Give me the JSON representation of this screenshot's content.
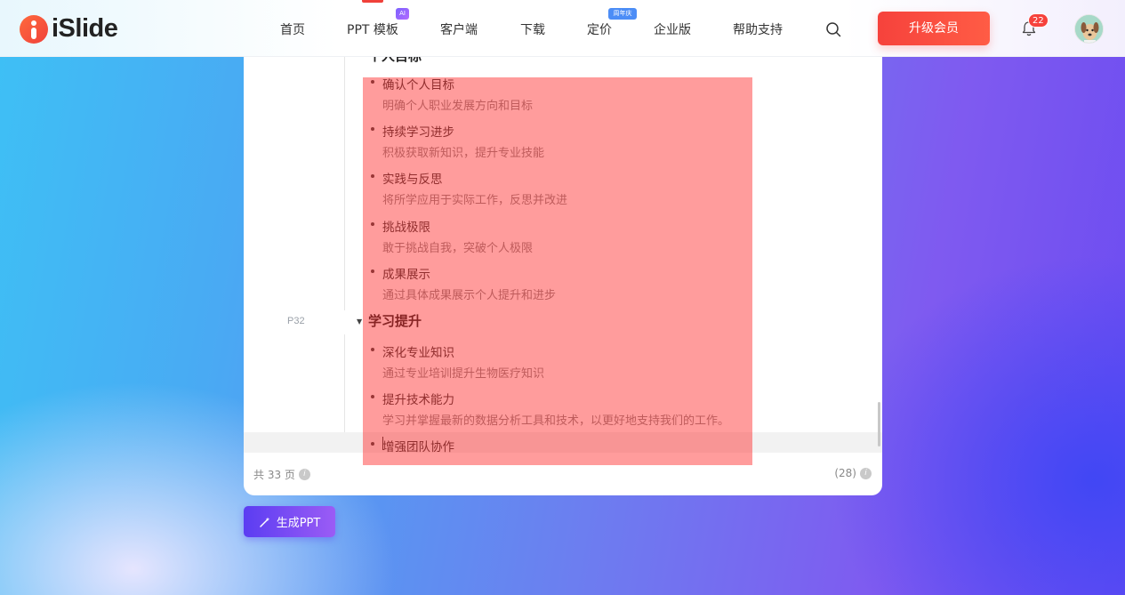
{
  "brand": {
    "name": "iSlide"
  },
  "nav": {
    "items": [
      "首页",
      "PPT 模板",
      "客户端",
      "下载",
      "定价",
      "企业版",
      "帮助支持"
    ],
    "ai_badge": "AI",
    "anniversary_badge": "周年庆"
  },
  "header": {
    "upgrade_label": "升级会员",
    "notification_count": "22",
    "icons": [
      "search-icon",
      "bell-icon",
      "avatar"
    ]
  },
  "outline": {
    "page_label": "P32",
    "section_top_partial": "个人目标",
    "items_top": [
      {
        "title": "确认个人目标",
        "desc": "明确个人职业发展方向和目标"
      },
      {
        "title": "持续学习进步",
        "desc": "积极获取新知识，提升专业技能"
      },
      {
        "title": "实践与反思",
        "desc": "将所学应用于实际工作，反思并改进"
      },
      {
        "title": "挑战极限",
        "desc": "敢于挑战自我，突破个人极限"
      },
      {
        "title": "成果展示",
        "desc": "通过具体成果展示个人提升和进步"
      }
    ],
    "section_heading": "学习提升",
    "items_bottom": [
      {
        "title": "深化专业知识",
        "desc": "通过专业培训提升生物医疗知识"
      },
      {
        "title": "提升技术能力",
        "desc": "学习并掌握最新的数据分析工具和技术，以更好地支持我们的工作。"
      },
      {
        "title": "增强团队协作",
        "desc": ""
      }
    ]
  },
  "footer": {
    "total_pages": "共 33 页",
    "count": "(28)"
  },
  "generate_button": {
    "label": "生成PPT"
  },
  "colors": {
    "accent_red": "#f6423c",
    "overlay_red": "#ff2828",
    "generate_purple": "#5b3df2"
  }
}
